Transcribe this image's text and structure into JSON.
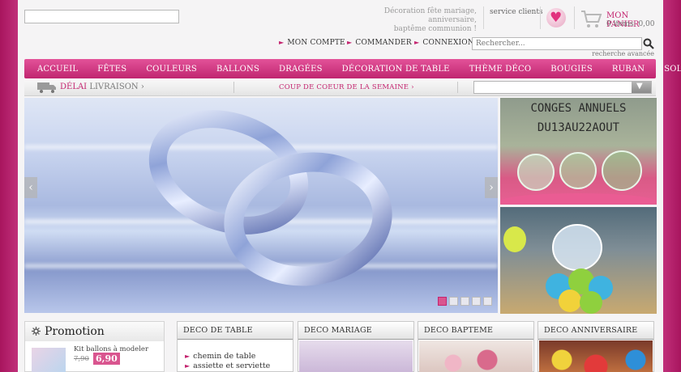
{
  "header": {
    "tagline_line1": "Décoration fête mariage, anniversaire,",
    "tagline_line2": "baptême communion !",
    "service_clients": "service clients",
    "cart_title": "MON PANIER",
    "cart_items": "0 items: 0,00"
  },
  "account_nav": [
    {
      "label": "MON COMPTE"
    },
    {
      "label": "COMMANDER"
    },
    {
      "label": "CONNEXION"
    }
  ],
  "search": {
    "placeholder": "Rechercher...",
    "advanced": "recherche avancée"
  },
  "menu": [
    "ACCUEIL",
    "FÊTES",
    "COULEURS",
    "BALLONS",
    "DRAGÉES",
    "DÉCORATION DE TABLE",
    "THÈME DÉCO",
    "BOUGIES",
    "RUBAN",
    "SOLDES"
  ],
  "subbar": {
    "delai_highlight": "DÉLAI",
    "delai_rest": "LIVRAISON",
    "coup_de_coeur": "COUP DE COEUR DE LA SEMAINE"
  },
  "slider": {
    "dots": 5,
    "active_dot": 0
  },
  "banner": {
    "line1": "CONGES ANNUELS",
    "line2": "DU13AU22AOUT"
  },
  "promotion": {
    "title": "Promotion",
    "item_name": "Kit ballons à modeler",
    "old_price": "7,90",
    "new_price": "6,90"
  },
  "categories": [
    {
      "title": "DECO DE TABLE",
      "links": [
        "chemin de table",
        "assiette et serviette"
      ]
    },
    {
      "title": "DECO MARIAGE"
    },
    {
      "title": "DECO BAPTEME"
    },
    {
      "title": "DECO ANNIVERSAIRE"
    }
  ],
  "colors": {
    "accent": "#c4246f",
    "menu_top": "#e35299",
    "menu_bottom": "#c02670"
  }
}
